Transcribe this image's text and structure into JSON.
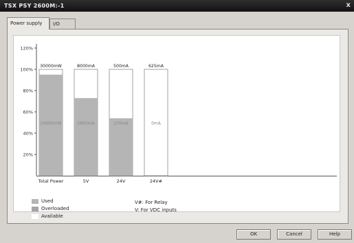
{
  "window": {
    "title": "TSX PSY 2600M:-1",
    "close_glyph": "x"
  },
  "tabs": [
    {
      "label": "Power supply"
    },
    {
      "label": "I/O"
    }
  ],
  "legend": {
    "used": "Used",
    "overloaded": "Overloaded",
    "available": "Available",
    "colors": {
      "used": "#b5b5b5",
      "overloaded": "#a5a5a5",
      "available": "#ffffff"
    }
  },
  "notes": {
    "line1": "V#: For Relay",
    "line2": "V: For VDC inputs"
  },
  "buttons": {
    "ok": "OK",
    "cancel": "Cancel",
    "help": "Help"
  },
  "chart_data": {
    "type": "bar",
    "ytick_labels": [
      "20%",
      "40%",
      "60%",
      "80%",
      "100%",
      "120%"
    ],
    "ylim": [
      0,
      120
    ],
    "categories": [
      "Total Power",
      "5V",
      "24V",
      "24V#"
    ],
    "capacity_labels": [
      "30000mW",
      "8000mA",
      "500mA",
      "625mA"
    ],
    "used_labels": [
      "24600mW",
      "5800mA",
      "270mA",
      "0mA"
    ],
    "used_percent": [
      95,
      73,
      54,
      0
    ],
    "colors": {
      "used": "#b5b5b5",
      "available": "#ffffff",
      "axis": "#555555"
    }
  }
}
